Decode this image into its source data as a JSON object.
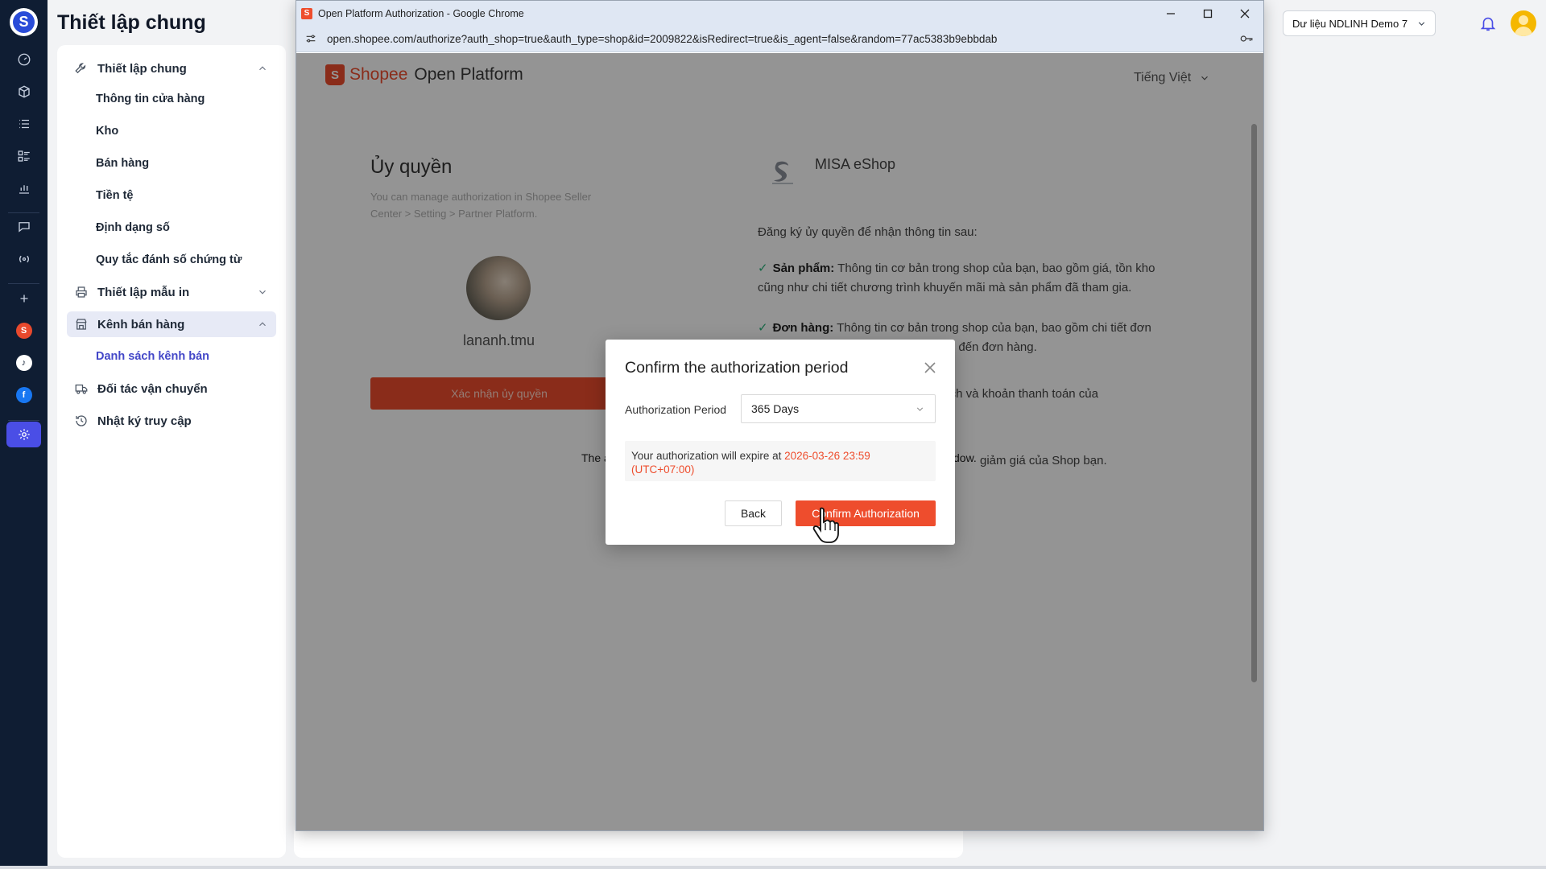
{
  "sidebar": {
    "page_title": "Thiết lập chung",
    "groups": [
      {
        "label": "Thiết lập chung",
        "icon": "wrench-icon",
        "expanded": true,
        "items": [
          "Thông tin cửa hàng",
          "Kho",
          "Bán hàng",
          "Tiền tệ",
          "Định dạng số",
          "Quy tắc đánh số chứng từ"
        ]
      },
      {
        "label": "Thiết lập mẫu in",
        "icon": "printer-icon",
        "expanded": false
      },
      {
        "label": "Kênh bán hàng",
        "icon": "store-icon",
        "expanded": true,
        "active": true,
        "items": [
          "Danh sách kênh bán"
        ]
      },
      {
        "label": "Đối tác vận chuyển",
        "icon": "truck-icon"
      },
      {
        "label": "Nhật ký truy cập",
        "icon": "history-icon"
      }
    ]
  },
  "topbar": {
    "shop_selector": "Dư liệu NDLINH Demo 7"
  },
  "browser": {
    "title": "Open Platform Authorization - Google Chrome",
    "url": "open.shopee.com/authorize?auth_shop=true&auth_type=shop&id=2009822&isRedirect=true&is_agent=false&random=77ac5383b9ebbdab"
  },
  "shopee_page": {
    "brand": "Shopee",
    "platform": "Open Platform",
    "language": "Tiếng Việt",
    "auth_title": "Ủy quyền",
    "auth_desc": "You can manage authorization in Shopee Seller Center > Setting > Partner Platform.",
    "shop_name": "lananh.tmu",
    "confirm_button": "Xác nhận ủy quyền",
    "footer_note_left": "The a",
    "footer_note_right": "dow.",
    "app_name": "MISA eShop",
    "perm_intro": "Đăng ký ủy quyền để nhận thông tin sau:",
    "permissions": [
      {
        "title": "Sản phẩm:",
        "text": "Thông tin cơ bản trong shop của bạn, bao gồm giá, tồn kho cũng như chi tiết chương trình khuyến mãi mà sản phẩm đã tham gia."
      },
      {
        "title": "Đơn hàng:",
        "text": "Thông tin cơ bản trong shop của bạn, bao gồm chi tiết đơn hàng, thông tin vận chuyển liên quan đến đơn hàng."
      },
      {
        "title": "",
        "text": "dịch và khoản thanh toán của"
      },
      {
        "title": "",
        "text": "giảm giá của Shop bạn."
      }
    ]
  },
  "modal": {
    "title": "Confirm the authorization period",
    "period_label": "Authorization Period",
    "period_value": "365 Days",
    "expiry_text": "Your authorization will expire at",
    "expiry_date": "2026-03-26 23:59",
    "expiry_tz": "(UTC+07:00)",
    "back_label": "Back",
    "confirm_label": "Confirm Authorization"
  },
  "colors": {
    "rail_bg": "#0f1d33",
    "accent": "#4a4ee6",
    "shopee_orange": "#ee4d2d"
  }
}
